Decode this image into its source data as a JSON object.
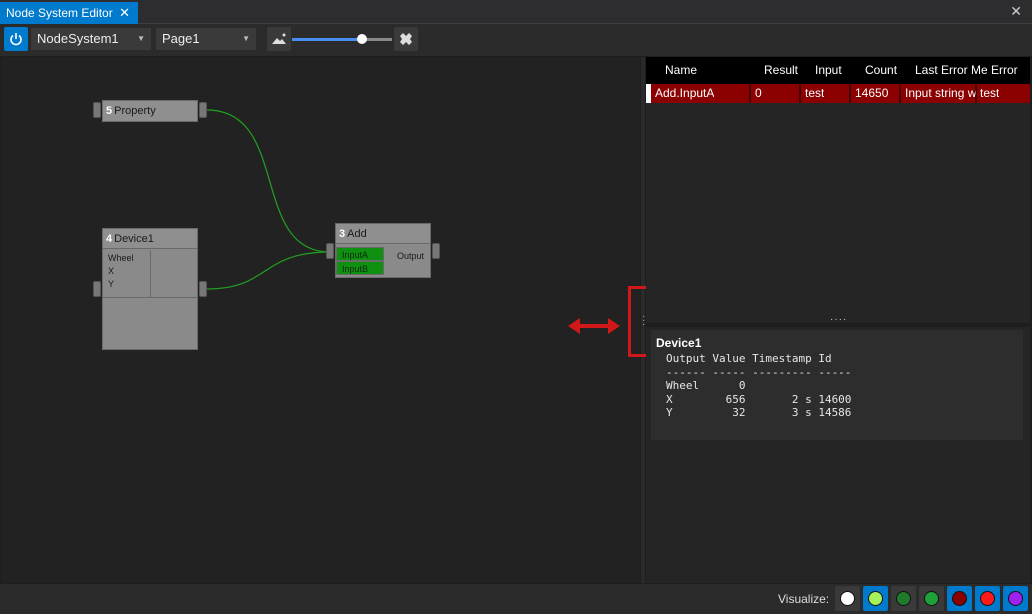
{
  "tab": {
    "title": "Node System Editor",
    "close": "✕"
  },
  "window": {
    "close": "✕"
  },
  "toolbar": {
    "system_combo": "NodeSystem1",
    "page_combo": "Page1",
    "zoom": 0.7
  },
  "nodes": {
    "property": {
      "id": "5",
      "title": "Property"
    },
    "device": {
      "id": "4",
      "title": "Device1",
      "outputs": [
        "Wheel",
        "X",
        "Y"
      ]
    },
    "add": {
      "id": "3",
      "title": "Add",
      "inputs": [
        "InputA",
        "InputB"
      ],
      "output": "Output"
    }
  },
  "grid": {
    "columns": [
      "Name",
      "Result",
      "Input",
      "Count",
      "Last Error Me",
      "Error"
    ],
    "rows": [
      {
        "name": "Add.InputA",
        "result": "0",
        "input": "test",
        "count": "14650",
        "last_error": "Input string w",
        "error": "test"
      }
    ]
  },
  "detail": {
    "title": "Device1",
    "table": "Output Value Timestamp Id\n------ ----- --------- -----\nWheel      0\nX        656       2 s 14600\nY         32       3 s 14586"
  },
  "status": {
    "visualize_label": "Visualize:",
    "colors": [
      "#ffffff",
      "#a6f05a",
      "#1f7a2c",
      "#1fa13a",
      "#8b0000",
      "#ff1a1a",
      "#a020f0"
    ],
    "active": [
      false,
      true,
      false,
      false,
      true,
      true,
      true
    ]
  },
  "colors": {
    "accent": "#007acc",
    "error_row": "#8b0000",
    "pin_active": "#109010"
  }
}
